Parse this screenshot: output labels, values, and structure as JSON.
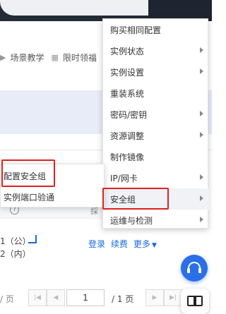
{
  "toolbar": {
    "items": [
      {
        "label": "场景教学",
        "icon": "caret-right-icon"
      },
      {
        "label": "限时领福",
        "icon": "qr-code-icon"
      }
    ]
  },
  "table": {
    "help_icon_glyph": "?",
    "clipped_header": "採",
    "row": {
      "ip_public": "1（公）",
      "ip_private": "2（内）",
      "actions": [
        "登录",
        "续费",
        "更多"
      ],
      "more_caret": "▼"
    }
  },
  "pagination": {
    "per_page_suffix": "/ 页",
    "current_page": "1",
    "total_pages": "/ 1 页"
  },
  "context_menu": {
    "items": [
      {
        "label": "购买相同配置",
        "has_submenu": false
      },
      {
        "label": "实例状态",
        "has_submenu": true
      },
      {
        "label": "实例设置",
        "has_submenu": true
      },
      {
        "label": "重装系统",
        "has_submenu": false
      },
      {
        "label": "密码/密钥",
        "has_submenu": true
      },
      {
        "label": "资源调整",
        "has_submenu": true
      },
      {
        "label": "制作镜像",
        "has_submenu": false
      },
      {
        "label": "IP/网卡",
        "has_submenu": true
      },
      {
        "label": "安全组",
        "has_submenu": true,
        "active": true
      },
      {
        "label": "运维与检测",
        "has_submenu": true
      }
    ]
  },
  "security_group_submenu": {
    "items": [
      {
        "label": "配置安全组"
      },
      {
        "label": "实例端口验通"
      }
    ]
  },
  "highlight_color": "#e02020",
  "accent_color": "#1a6ae0",
  "floating": {
    "support_icon": "headset-icon",
    "docs_icon": "book-icon"
  }
}
